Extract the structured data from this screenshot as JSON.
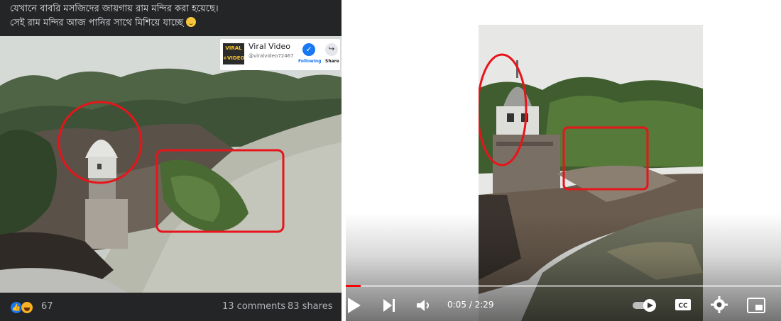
{
  "facebook_post": {
    "caption_line1": "যেখানে বাবরি মসজিদের জায়গায় রাম মন্দির করা হয়েছে।",
    "caption_line2": "সেই রাম মন্দির আজ পানির সাথে মিশিয়ে যাচ্ছে",
    "caption_emoji": "smile-emoji",
    "channel": {
      "logo_line1": "VIRAL",
      "logo_line2": "+VIDEO",
      "name": "Viral Video",
      "handle": "@viralvideo72467",
      "follow_label": "Following",
      "share_label": "Share"
    },
    "reactions": [
      "like",
      "haha"
    ],
    "reaction_count": "67",
    "comments": "13 comments",
    "shares": "83 shares",
    "icons": {
      "mute": "speaker-muted-icon",
      "follow": "following-check-icon",
      "share": "share-arrow-icon"
    }
  },
  "youtube_player": {
    "time_display": "0:05 / 2:29",
    "progress_fraction": 0.034,
    "icons": {
      "play": "play-icon",
      "next": "next-track-icon",
      "volume": "volume-icon",
      "autoplay": "autoplay-toggle-icon",
      "captions": "cc-icon",
      "settings": "gear-icon",
      "miniplayer": "miniplayer-icon"
    }
  },
  "colors": {
    "fb_background": "#242526",
    "highlight_red": "#e8141b",
    "yt_progress": "#ff0000",
    "fb_blue": "#1877f2"
  }
}
